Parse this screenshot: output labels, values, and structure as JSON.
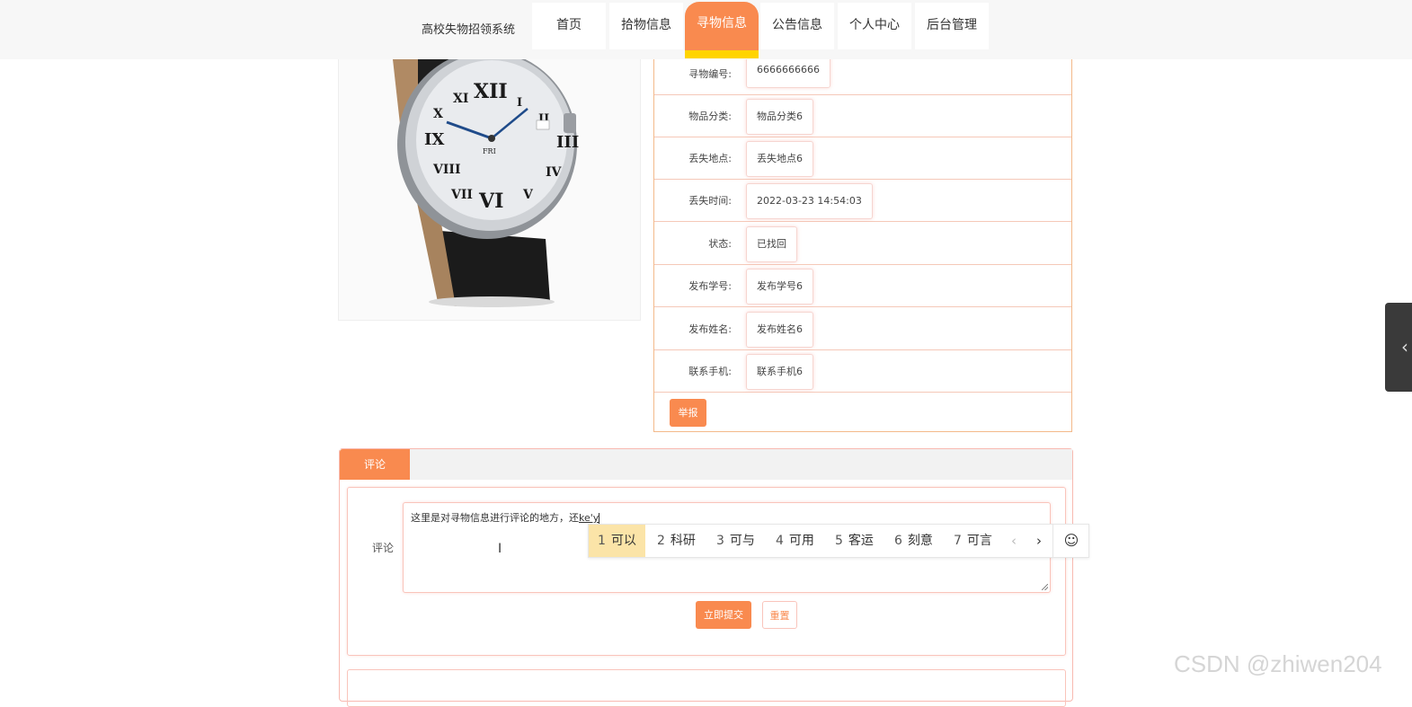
{
  "header": {
    "site_title": "高校失物招领系统",
    "nav": [
      {
        "label": "首页"
      },
      {
        "label": "拾物信息"
      },
      {
        "label": "寻物信息",
        "active": true
      },
      {
        "label": "公告信息"
      },
      {
        "label": "个人中心"
      },
      {
        "label": "后台管理"
      }
    ]
  },
  "detail": {
    "rows": [
      {
        "label": "寻物编号:",
        "value": "6666666666"
      },
      {
        "label": "物品分类:",
        "value": "物品分类6"
      },
      {
        "label": "丢失地点:",
        "value": "丢失地点6"
      },
      {
        "label": "丢失时间:",
        "value": "2022-03-23 14:54:03"
      },
      {
        "label": "状态:",
        "value": "已找回"
      },
      {
        "label": "发布学号:",
        "value": "发布学号6"
      },
      {
        "label": "发布姓名:",
        "value": "发布姓名6"
      },
      {
        "label": "联系手机:",
        "value": "联系手机6"
      }
    ],
    "report_label": "举报"
  },
  "comment": {
    "tab_label": "评论",
    "field_label": "评论",
    "text_value": "这里是对寻物信息进行评论的地方，还",
    "ime_composing": "ke'y",
    "submit_label": "立即提交",
    "reset_label": "重置"
  },
  "ime": {
    "candidates": [
      {
        "n": "1",
        "text": "可以"
      },
      {
        "n": "2",
        "text": "科研"
      },
      {
        "n": "3",
        "text": "可与"
      },
      {
        "n": "4",
        "text": "可用"
      },
      {
        "n": "5",
        "text": "客运"
      },
      {
        "n": "6",
        "text": "刻意"
      },
      {
        "n": "7",
        "text": "可言"
      }
    ],
    "prev": "‹",
    "next": "›",
    "emoji": "☺"
  },
  "side_tab_icon": "‹",
  "watermark": "CSDN @zhiwen204",
  "colors": {
    "accent": "#f98a4f",
    "highlight": "#ffd400",
    "ime_selected": "#fbe4a8"
  }
}
